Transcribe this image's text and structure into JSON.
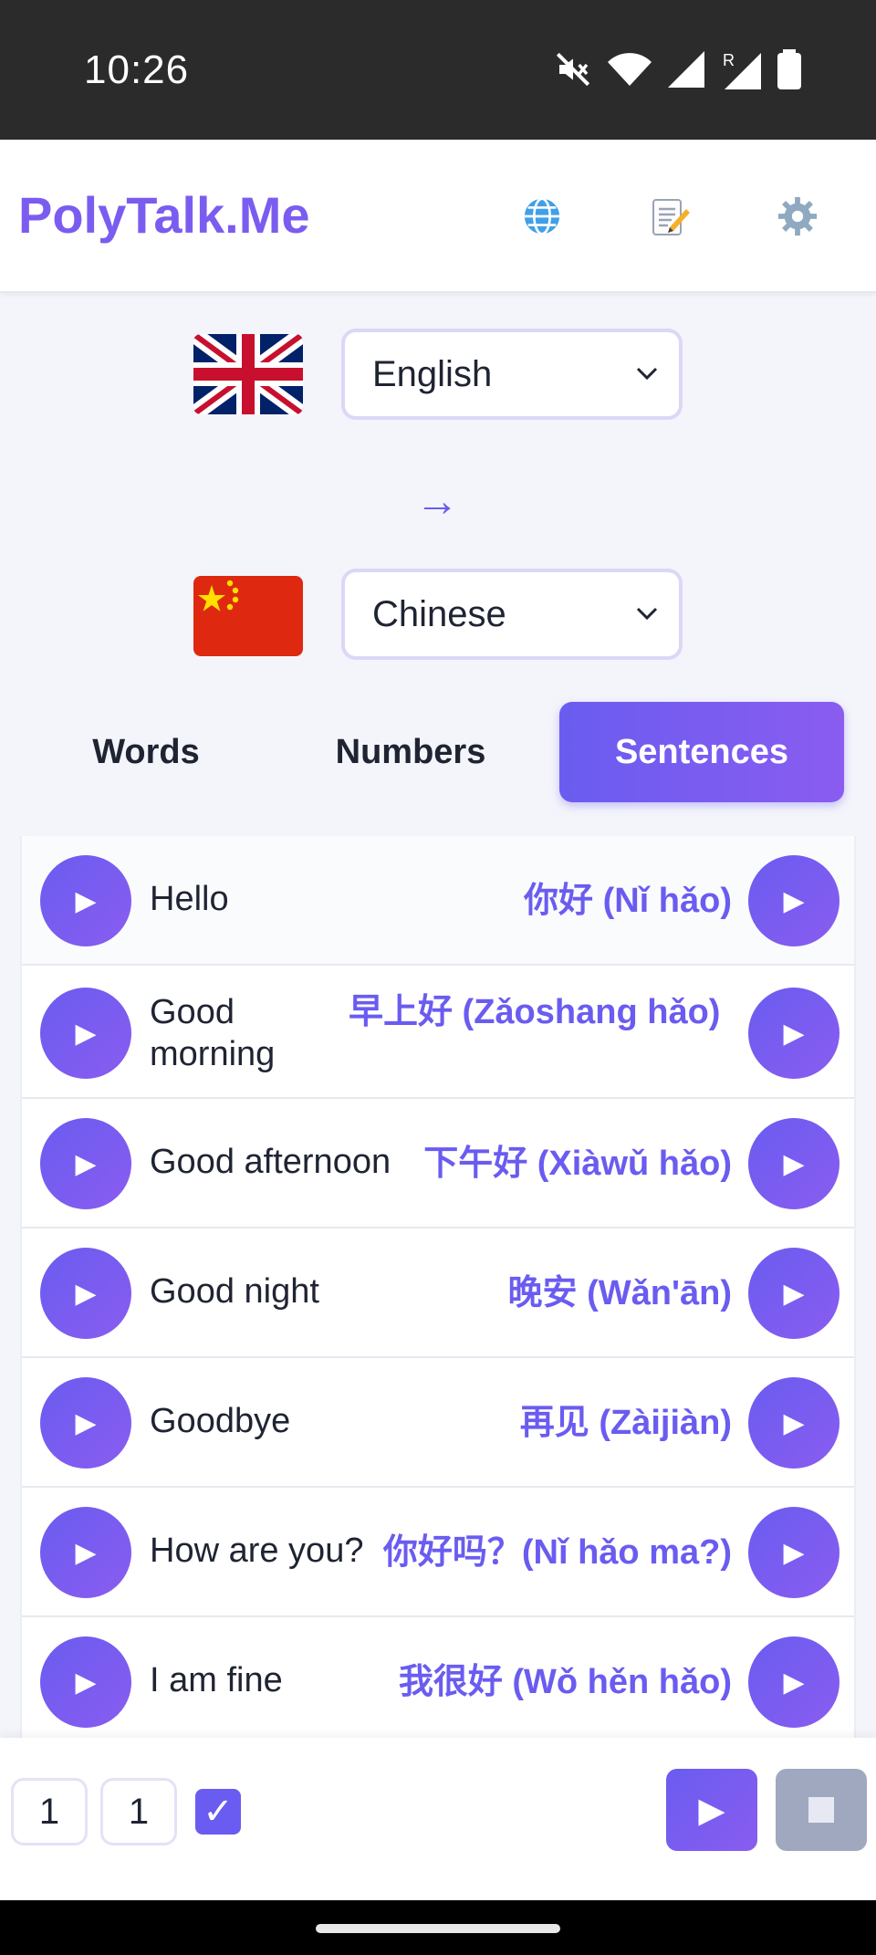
{
  "status": {
    "time": "10:26"
  },
  "header": {
    "brand": "PolyTalk.Me",
    "icons": [
      "globe-icon",
      "memo-icon",
      "gear-icon"
    ]
  },
  "languages": {
    "source": "English",
    "target": "Chinese",
    "arrow": "→"
  },
  "tabs": [
    {
      "label": "Words",
      "active": false
    },
    {
      "label": "Numbers",
      "active": false
    },
    {
      "label": "Sentences",
      "active": true
    }
  ],
  "phrases": [
    {
      "src": "Hello",
      "tgt": "你好 (Nǐ hǎo)"
    },
    {
      "src": "Good morning",
      "tgt": "早上好 (Zǎoshang hǎo)"
    },
    {
      "src": "Good afternoon",
      "tgt": "下午好 (Xiàwǔ hǎo)"
    },
    {
      "src": "Good night",
      "tgt": "晚安 (Wǎn'ān)"
    },
    {
      "src": "Goodbye",
      "tgt": "再见 (Zàijiàn)"
    },
    {
      "src": "How are you?",
      "tgt": "你好吗？(Nǐ hǎo ma?)"
    },
    {
      "src": "I am fine",
      "tgt": "我很好 (Wǒ hěn hǎo)"
    }
  ],
  "controls": {
    "count_a": "1",
    "count_b": "1",
    "loop_checked": true,
    "play": "▶",
    "stop": "■"
  },
  "colors": {
    "accent": "#6a5cf0",
    "brand": "#7b5cf0",
    "stop": "#9fa8bf"
  }
}
